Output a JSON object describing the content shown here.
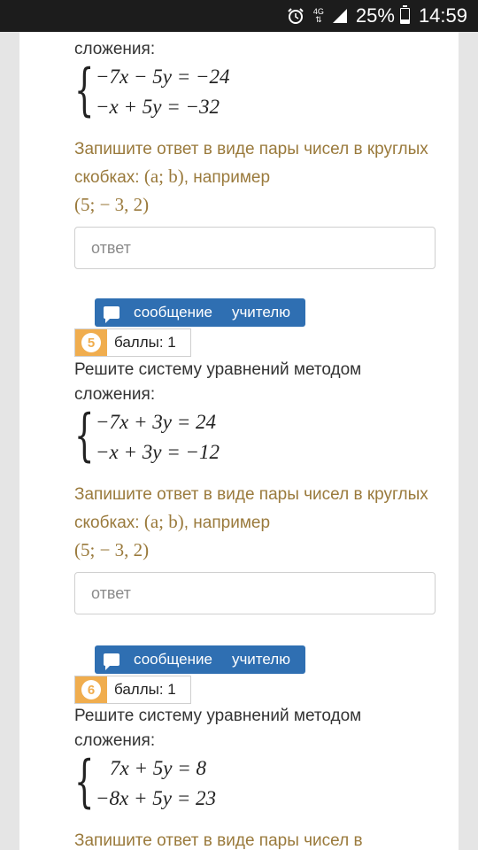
{
  "status_bar": {
    "alarm_icon": "alarm-clock-icon",
    "network_label": "4G",
    "battery_percent": "25%",
    "battery_level": 0.25,
    "time": "14:59"
  },
  "questions": [
    {
      "clipped_text_tail": "сложения:",
      "eq1": "−7x − 5y = −24",
      "eq2": "−x + 5y = −32",
      "hint_text": "Запишите ответ в виде пары чисел в круглых скобках: ",
      "hint_pair": "(a; b)",
      "hint_example_word": ", например",
      "hint_example": "(5;  − 3, 2)",
      "answer_placeholder": "ответ"
    },
    {
      "message_button_label": "сообщение",
      "message_button_label2": "учителю",
      "number": "5",
      "points_label": "баллы: 1",
      "prompt": "Решите систему уравнений методом сложения:",
      "eq1": "−7x + 3y = 24",
      "eq2": "−x + 3y = −12",
      "hint_text": "Запишите ответ в виде пары чисел в круглых скобках: ",
      "hint_pair": "(a; b)",
      "hint_example_word": ", например",
      "hint_example": "(5;  − 3, 2)",
      "answer_placeholder": "ответ"
    },
    {
      "message_button_label": "сообщение",
      "message_button_label2": "учителю",
      "number": "6",
      "points_label": "баллы: 1",
      "prompt": "Решите систему уравнений методом сложения:",
      "eq1": "7x + 5y = 8",
      "eq2": "−8x + 5y = 23",
      "hint_text_clipped": "Запишите ответ в виде пары чисел в"
    }
  ]
}
